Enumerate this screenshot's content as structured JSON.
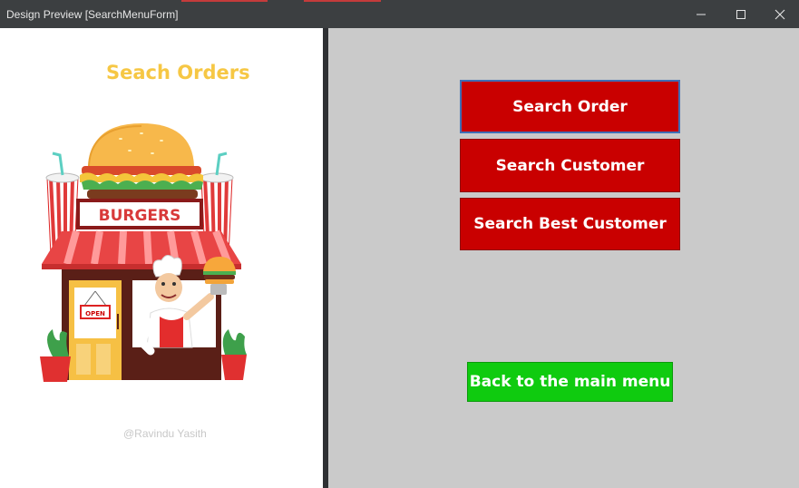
{
  "window": {
    "title": "Design Preview [SearchMenuForm]",
    "controls": [
      "minimize-icon",
      "maximize-icon",
      "close-icon"
    ]
  },
  "left_panel": {
    "heading": "Seach Orders",
    "sign_text": "BURGERS",
    "door_sign": "OPEN",
    "credit": "@Ravindu Yasith"
  },
  "menu": {
    "search_order": "Search Order",
    "search_customer": "Search Customer",
    "search_best_customer": "Search Best Customer",
    "back": "Back to the main menu"
  },
  "colors": {
    "heading": "#f6c744",
    "button_red": "#c90000",
    "button_green": "#0fcb0f",
    "right_bg": "#cacaca",
    "focus_border": "#3f6fb6"
  }
}
